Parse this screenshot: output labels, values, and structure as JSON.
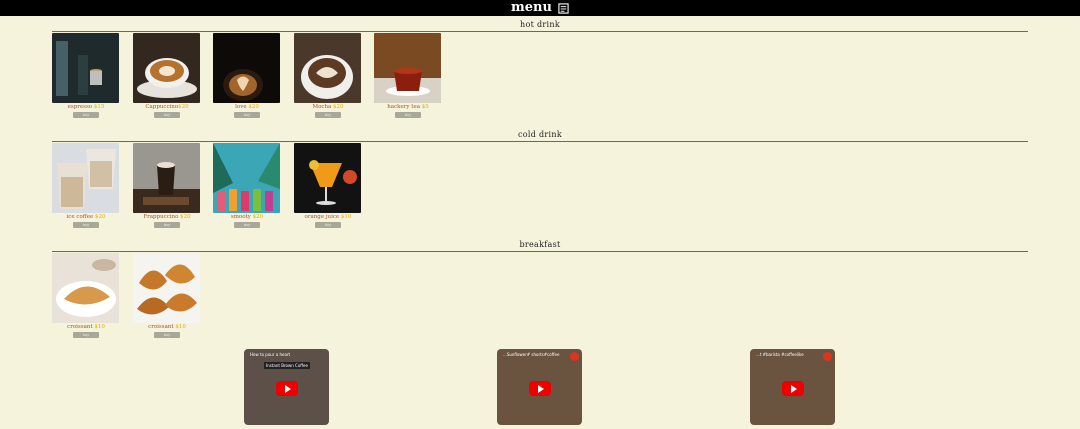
{
  "header": {
    "title": "menu",
    "icon": "menu-note-icon"
  },
  "sections": [
    {
      "title": "hot drink",
      "items": [
        {
          "name": "espresso",
          "price": "$15",
          "buy": "buy"
        },
        {
          "name": "Cappuccino",
          "price": "$20",
          "buy": "buy"
        },
        {
          "name": "love",
          "price": "$20",
          "buy": "buy"
        },
        {
          "name": "Mocha",
          "price": "$20",
          "buy": "buy"
        },
        {
          "name": "hackery tea",
          "price": "$5",
          "buy": "buy"
        }
      ]
    },
    {
      "title": "cold drink",
      "items": [
        {
          "name": "ice coffee",
          "price": "$20",
          "buy": "buy"
        },
        {
          "name": "Frappuccino",
          "price": "$20",
          "buy": "buy"
        },
        {
          "name": "smooty",
          "price": "$20",
          "buy": "buy"
        },
        {
          "name": "orange juice",
          "price": "$10",
          "buy": "buy"
        }
      ]
    },
    {
      "title": "breakfast",
      "items": [
        {
          "name": "croissant",
          "price": "$10",
          "buy": "buy"
        },
        {
          "name": "croissant",
          "price": "$10",
          "buy": "buy"
        }
      ]
    }
  ],
  "videos": [
    {
      "title": "How to pour a heart",
      "subtitle": "Instant Brown Coffee"
    },
    {
      "title": "...Sunflower# shorts#coffee",
      "subtitle": ""
    },
    {
      "title": "...t #barista #coffeelike",
      "subtitle": ""
    }
  ]
}
